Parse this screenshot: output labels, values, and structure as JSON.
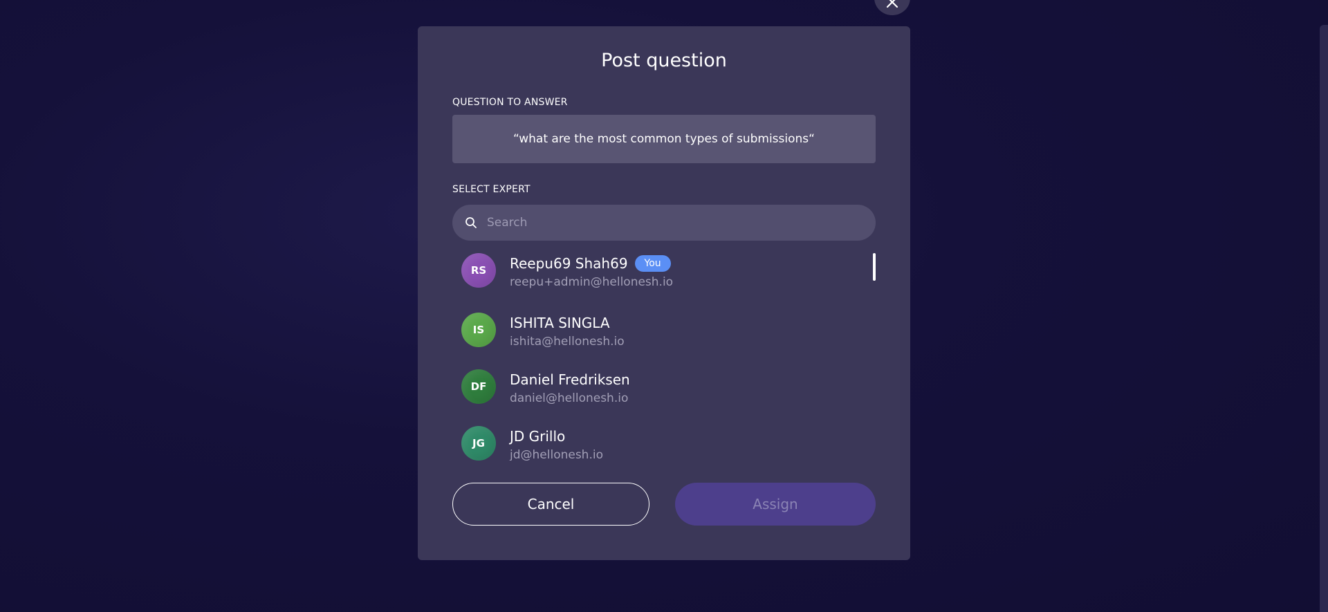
{
  "modal": {
    "title": "Post question",
    "question_label": "QUESTION TO ANSWER",
    "question_text": "“what are the most common types of submissions“",
    "expert_label": "SELECT EXPERT",
    "search": {
      "placeholder": "Search",
      "value": ""
    },
    "experts": [
      {
        "initials": "RS",
        "name": "Reepu69 Shah69",
        "badge": "You",
        "email": "reepu+admin@hellonesh.io",
        "avatar_color": "#8a4fb3"
      },
      {
        "initials": "IS",
        "name": "ISHITA SINGLA",
        "email": "ishita@hellonesh.io",
        "avatar_color": "#5aa84a"
      },
      {
        "initials": "DF",
        "name": "Daniel Fredriksen",
        "email": "daniel@hellonesh.io",
        "avatar_color": "#2f7d3d"
      },
      {
        "initials": "JG",
        "name": "JD Grillo",
        "email": "jd@hellonesh.io",
        "avatar_color": "#2f8a68"
      }
    ],
    "cancel_label": "Cancel",
    "assign_label": "Assign"
  },
  "colors": {
    "background": "#15113a",
    "modal": "#3b3758",
    "badge": "#5b8ff5",
    "assign_button": "#4d3f8c"
  },
  "icons": {
    "close": "close-icon",
    "search": "search-icon"
  }
}
